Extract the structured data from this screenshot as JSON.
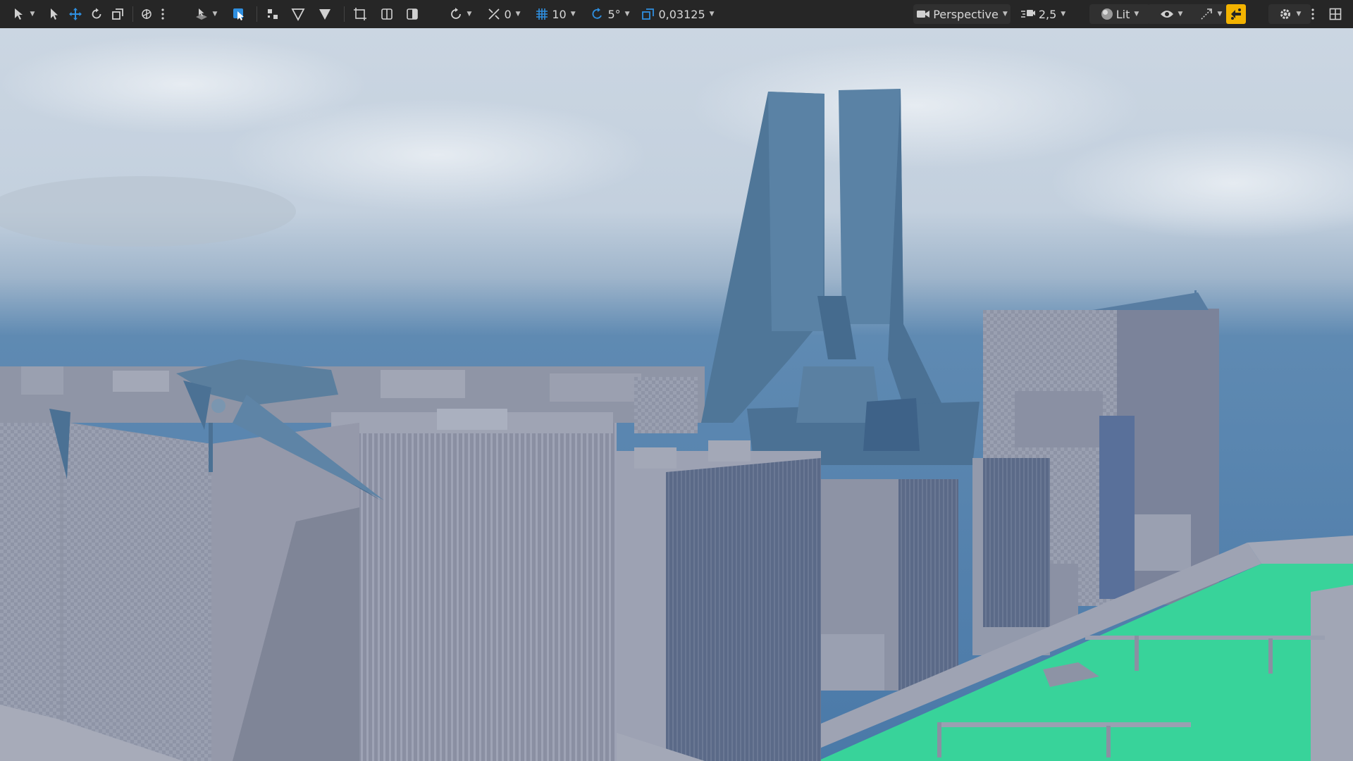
{
  "toolbar": {
    "snap_translate_value": "0",
    "grid_snap_value": "10",
    "rotation_snap_value": "5°",
    "scale_snap_value": "0,03125",
    "viewport_type_label": "Perspective",
    "camera_speed_value": "2,5",
    "view_mode_label": "Lit"
  },
  "colors": {
    "toolbar_bg": "#262626",
    "accent_highlight": "#f3b300",
    "select_active": "#2f8fe0"
  },
  "icons": [
    "select-mode-icon",
    "select-arrow-icon",
    "translate-icon",
    "rotate-icon",
    "scale-icon",
    "transform-space-icon",
    "more-icon",
    "surface-snap-icon",
    "blue-select-icon",
    "snap-points-icon",
    "triangle-outline-icon",
    "triangle-filled-icon",
    "frame-icon",
    "half-frame-icon",
    "shade-icon",
    "rotate-snap-icon",
    "drag-snap-icon",
    "grid-icon",
    "angle-snap-icon",
    "scale-snap-icon",
    "camera-icon",
    "camera-speed-icon",
    "lit-sphere-icon",
    "eye-icon",
    "realtime-icon",
    "game-view-icon",
    "settings-gear-icon",
    "kebab-menu-icon",
    "layout-grid-icon"
  ]
}
